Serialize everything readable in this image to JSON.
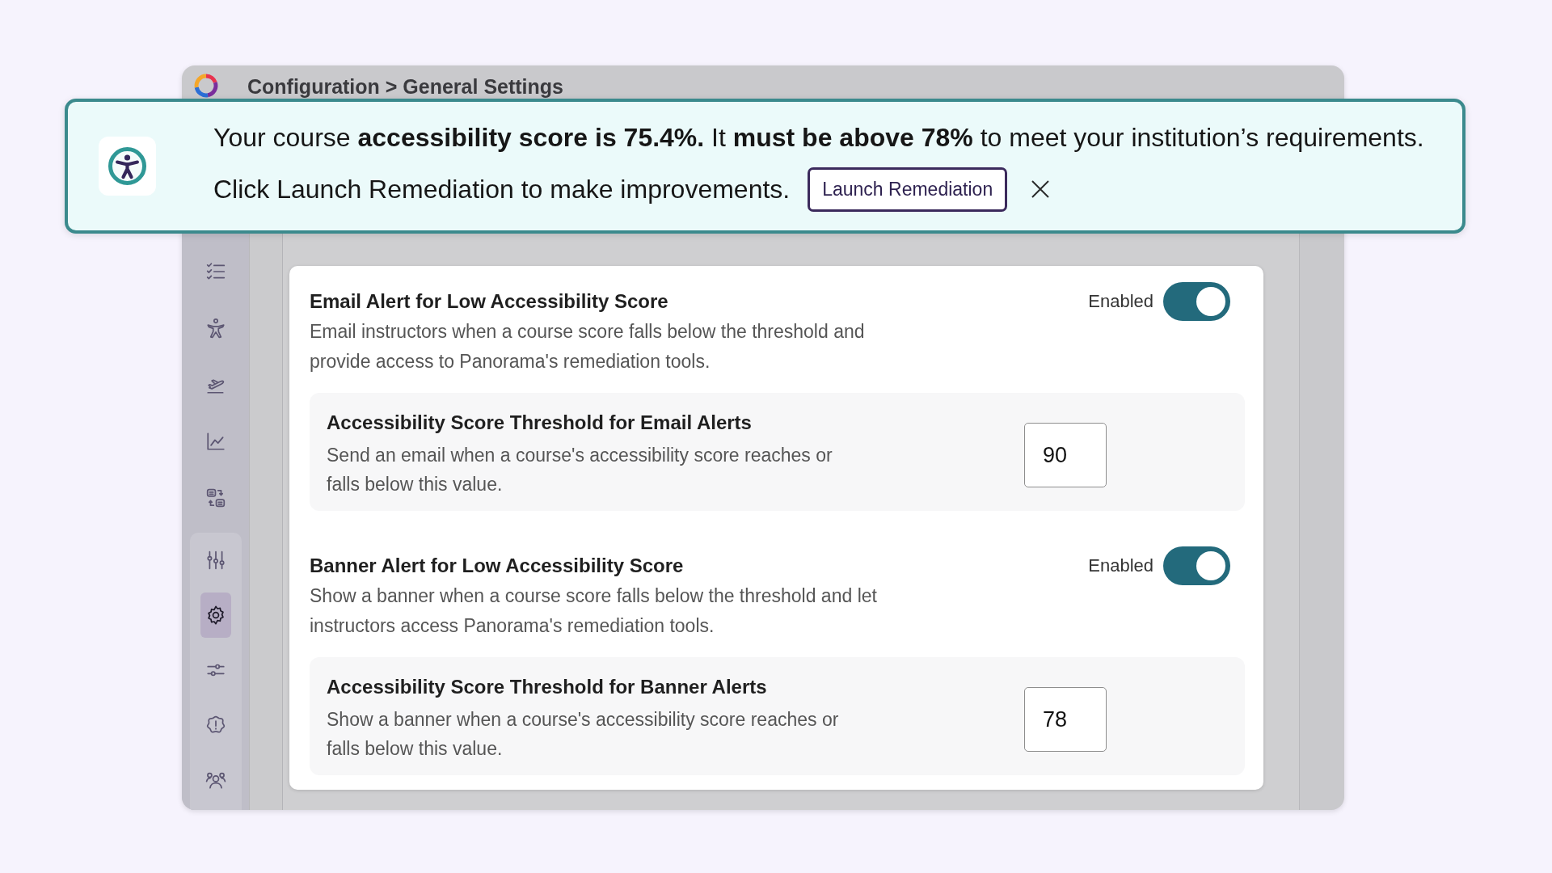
{
  "header": {
    "breadcrumb": "Configuration > General Settings"
  },
  "banner": {
    "message": "Your course **accessibility score is 75.4%.** It **must be above 78%** to meet your institution’s requirements.",
    "prompt": "Click Launch Remediation to make improvements.",
    "action": "Launch Remediation"
  },
  "sidebar": {
    "items": [
      {
        "selected": false
      },
      {
        "selected": false
      },
      {
        "selected": false
      },
      {
        "selected": false
      },
      {
        "selected": false
      },
      {
        "selected": false,
        "expanded": true,
        "children": [
          {
            "selected": true
          },
          {
            "selected": false
          },
          {
            "selected": false
          },
          {
            "selected": false
          }
        ]
      }
    ]
  },
  "settings": [
    {
      "title": "Email Alert for Low Accessibility Score",
      "description": "Email instructors when a course score falls below the threshold and provide access to Panorama's remediation tools.",
      "toggle_label": "Enabled",
      "enabled": true,
      "threshold": {
        "title": "Accessibility Score Threshold for Email Alerts",
        "description": "Send an email when a course's accessibility score reaches or falls below this value.",
        "value": "90"
      }
    },
    {
      "title": "Banner Alert for Low Accessibility Score",
      "description": "Show a banner when a course score falls below the threshold and let instructors access Panorama's remediation tools.",
      "toggle_label": "Enabled",
      "enabled": true,
      "threshold": {
        "title": "Accessibility Score Threshold for Banner Alerts",
        "description": "Show a banner when a course's accessibility score reaches or falls below this value.",
        "value": "78"
      }
    }
  ]
}
